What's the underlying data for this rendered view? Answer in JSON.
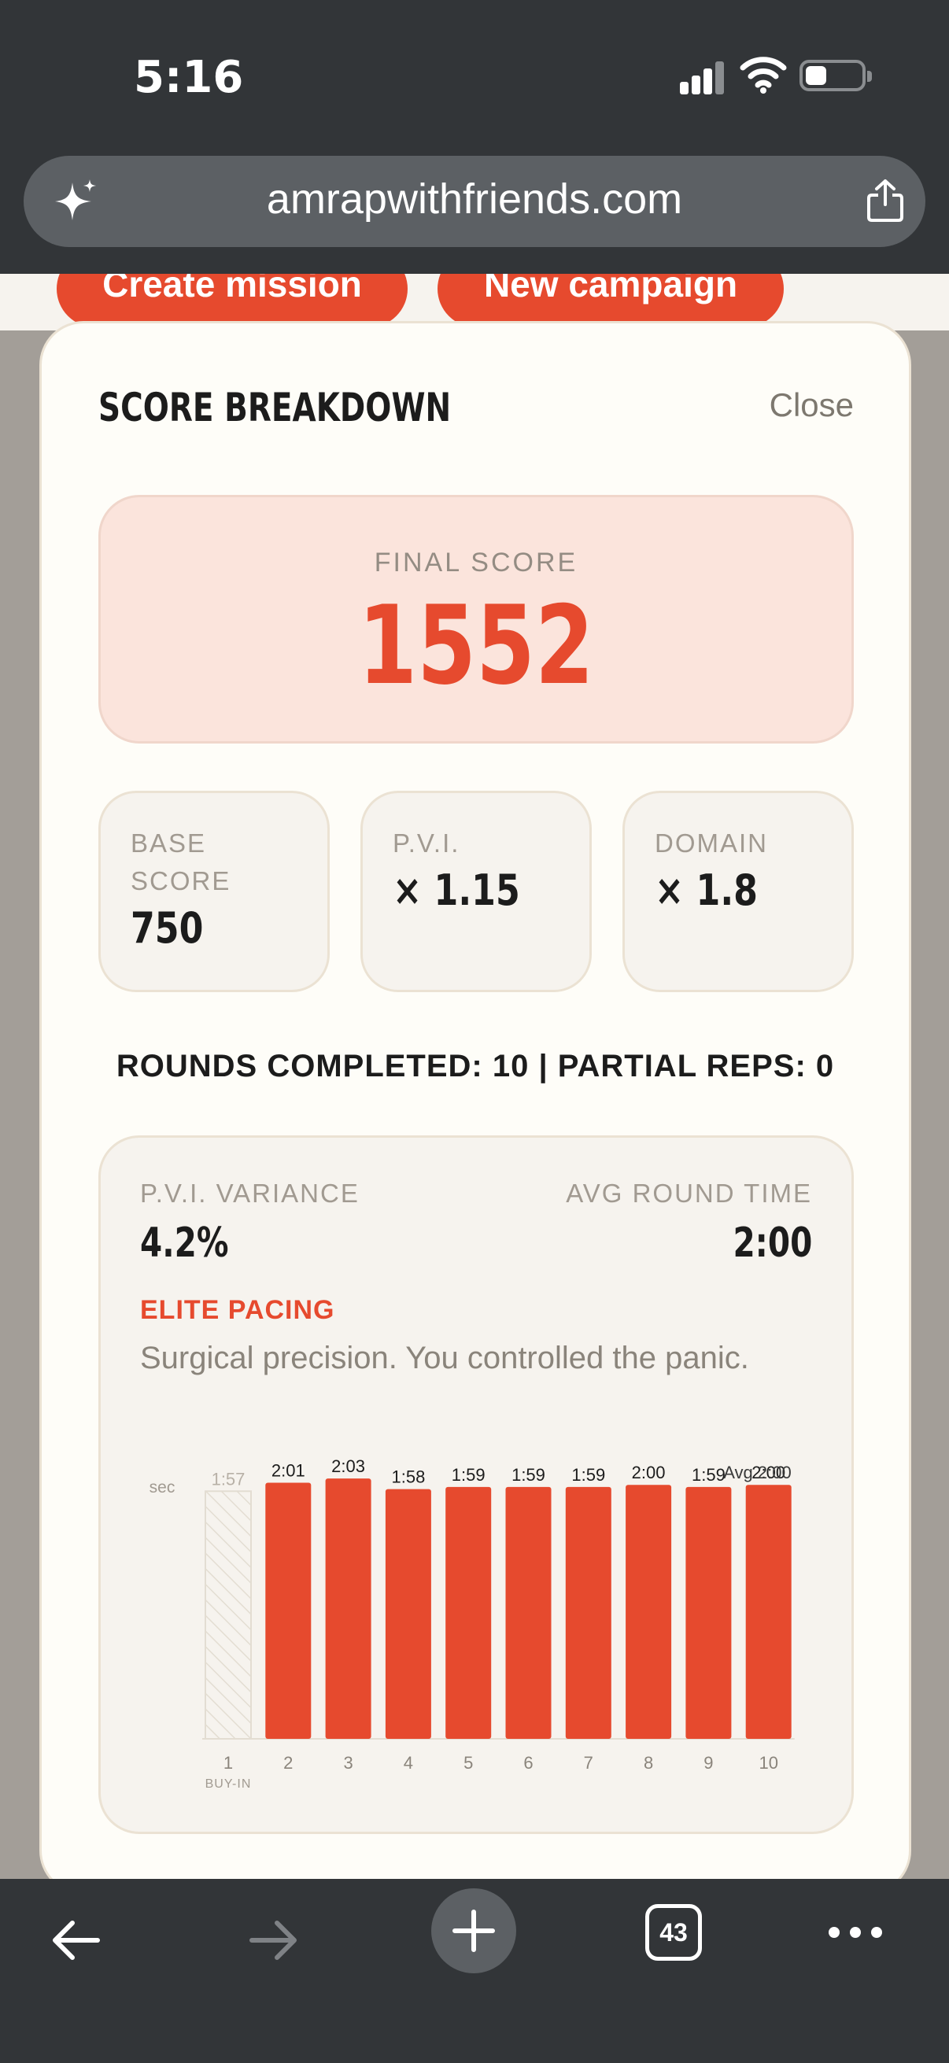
{
  "status_bar": {
    "time": "5:16"
  },
  "browser": {
    "url": "amrapwithfriends.com",
    "tab_count": "43"
  },
  "page": {
    "buttons": [
      "Create mission",
      "New campaign"
    ]
  },
  "modal": {
    "title": "SCORE BREAKDOWN",
    "close_label": "Close",
    "final_score": {
      "label": "FINAL SCORE",
      "value": "1552"
    },
    "cards": [
      {
        "label": "BASE SCORE",
        "value": "750"
      },
      {
        "label": "P.V.I.",
        "value": "× 1.15"
      },
      {
        "label": "DOMAIN",
        "value": "× 1.8"
      }
    ],
    "rounds_summary": "ROUNDS COMPLETED: 10 | PARTIAL REPS: 0",
    "pacing": {
      "variance_label": "P.V.I. VARIANCE",
      "variance_value": "4.2%",
      "avg_label": "AVG ROUND TIME",
      "avg_value": "2:00",
      "rating": "ELITE PACING",
      "description": "Surgical precision. You controlled the panic."
    }
  },
  "chart_data": {
    "type": "bar",
    "ylabel": "sec",
    "categories": [
      "1",
      "2",
      "3",
      "4",
      "5",
      "6",
      "7",
      "8",
      "9",
      "10"
    ],
    "category_sublabels": [
      "BUY-IN",
      "",
      "",
      "",
      "",
      "",
      "",
      "",
      "",
      ""
    ],
    "value_labels": [
      "1:57",
      "2:01",
      "2:03",
      "1:58",
      "1:59",
      "1:59",
      "1:59",
      "2:00",
      "1:59",
      "2:00"
    ],
    "values": [
      117,
      121,
      123,
      118,
      119,
      119,
      119,
      120,
      119,
      120
    ],
    "buy_in_index": 0,
    "average_label": "Avg 2:00",
    "average_value": 120,
    "bar_color": "#e64a2e"
  },
  "colors": {
    "accent": "#e64a2e",
    "chrome": "#323538",
    "modal_bg": "#fefdf8",
    "card_bg": "#f6f3ee"
  }
}
